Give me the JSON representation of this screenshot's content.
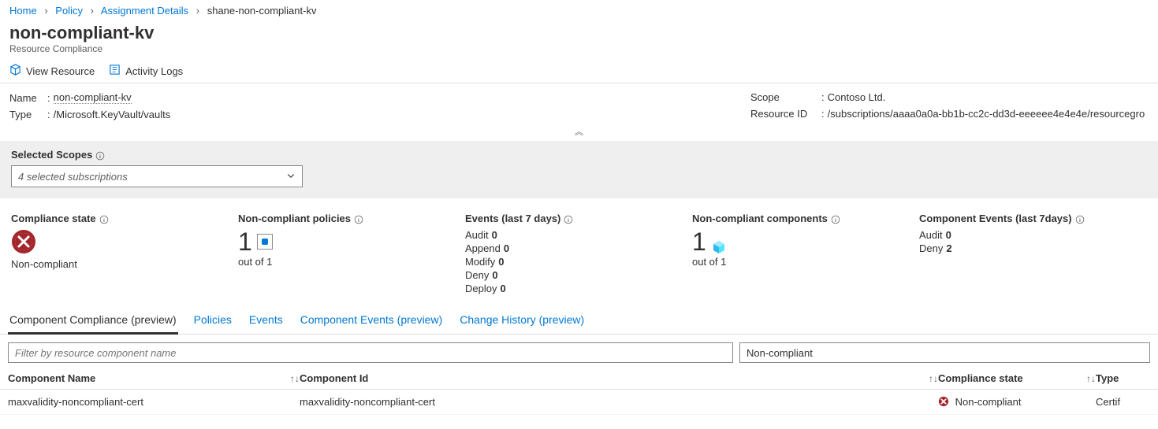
{
  "breadcrumb": [
    "Home",
    "Policy",
    "Assignment Details",
    "shane-non-compliant-kv"
  ],
  "title": "non-compliant-kv",
  "subtitle": "Resource Compliance",
  "toolbar": {
    "view_resource": "View Resource",
    "activity_logs": "Activity Logs"
  },
  "props": {
    "name_label": "Name",
    "name_value": "non-compliant-kv",
    "type_label": "Type",
    "type_value": "/Microsoft.KeyVault/vaults",
    "scope_label": "Scope",
    "scope_value": "Contoso Ltd.",
    "resid_label": "Resource ID",
    "resid_value": "/subscriptions/aaaa0a0a-bb1b-cc2c-dd3d-eeeeee4e4e4e/resourcegro"
  },
  "scopes": {
    "label": "Selected Scopes",
    "selected": "4 selected subscriptions"
  },
  "kpi": {
    "compliance_state": {
      "title": "Compliance state",
      "status": "Non-compliant"
    },
    "noncompliant_policies": {
      "title": "Non-compliant policies",
      "value": "1",
      "sub": "out of 1"
    },
    "events": {
      "title": "Events (last 7 days)",
      "rows": [
        {
          "label": "Audit",
          "value": "0"
        },
        {
          "label": "Append",
          "value": "0"
        },
        {
          "label": "Modify",
          "value": "0"
        },
        {
          "label": "Deny",
          "value": "0"
        },
        {
          "label": "Deploy",
          "value": "0"
        }
      ]
    },
    "noncompliant_components": {
      "title": "Non-compliant components",
      "value": "1",
      "sub": "out of 1"
    },
    "component_events": {
      "title": "Component Events (last 7days)",
      "rows": [
        {
          "label": "Audit",
          "value": "0"
        },
        {
          "label": "Deny",
          "value": "2"
        }
      ]
    }
  },
  "tabs": [
    "Component Compliance (preview)",
    "Policies",
    "Events",
    "Component Events (preview)",
    "Change History (preview)"
  ],
  "filter": {
    "placeholder": "Filter by resource component name",
    "state_filter": "Non-compliant"
  },
  "columns": {
    "name": "Component Name",
    "id": "Component Id",
    "cs": "Compliance state",
    "type": "Type"
  },
  "rows": [
    {
      "name": "maxvalidity-noncompliant-cert",
      "id": "maxvalidity-noncompliant-cert",
      "cs": "Non-compliant",
      "type": "Certif"
    }
  ]
}
